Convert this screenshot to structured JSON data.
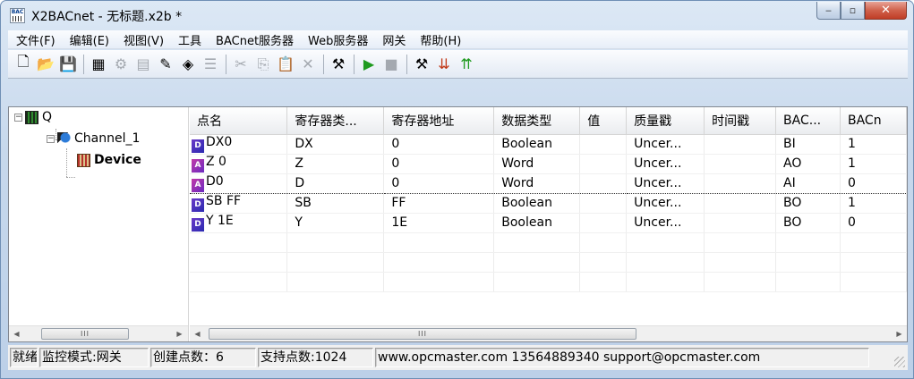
{
  "window": {
    "title": "X2BACnet - 无标题.x2b *",
    "app_icon_text": "BAC",
    "controls": {
      "minimize": "‒",
      "maximize": "▫",
      "close": "✕"
    }
  },
  "menu": [
    "文件(F)",
    "编辑(E)",
    "视图(V)",
    "工具",
    "BACnet服务器",
    "Web服务器",
    "网关",
    "帮助(H)"
  ],
  "toolbar": {
    "buttons": [
      {
        "icon": "new-file-icon",
        "glyph": "🗋",
        "enabled": true
      },
      {
        "icon": "open-folder-icon",
        "glyph": "📂",
        "enabled": true
      },
      {
        "icon": "save-icon",
        "glyph": "💾",
        "enabled": true
      },
      {
        "sep": true
      },
      {
        "icon": "add-channel-icon",
        "glyph": "▦",
        "enabled": true
      },
      {
        "icon": "add-device-icon",
        "glyph": "⚙",
        "enabled": false
      },
      {
        "icon": "add-tag-icon",
        "glyph": "▤",
        "enabled": false
      },
      {
        "icon": "new-tag-icon",
        "glyph": "✎",
        "enabled": true
      },
      {
        "icon": "tag-import-icon",
        "glyph": "◈",
        "enabled": true
      },
      {
        "icon": "properties-icon",
        "glyph": "☰",
        "enabled": false
      },
      {
        "sep": true
      },
      {
        "icon": "cut-icon",
        "glyph": "✂",
        "enabled": false
      },
      {
        "icon": "copy-icon",
        "glyph": "⎘",
        "enabled": false
      },
      {
        "icon": "paste-icon",
        "glyph": "📋",
        "enabled": false
      },
      {
        "icon": "delete-icon",
        "glyph": "✕",
        "enabled": false
      },
      {
        "sep": true
      },
      {
        "icon": "quick-client-icon",
        "glyph": "⚒",
        "enabled": true
      },
      {
        "sep": true
      },
      {
        "icon": "run-icon",
        "glyph": "▶",
        "enabled": true,
        "color": "#1f9a1f"
      },
      {
        "icon": "stop-icon",
        "glyph": "■",
        "enabled": false
      },
      {
        "sep": true
      },
      {
        "icon": "tools-icon",
        "glyph": "⚒",
        "enabled": true
      },
      {
        "icon": "load-icon",
        "glyph": "⇊",
        "enabled": true,
        "color": "#c23a1a"
      },
      {
        "icon": "upload-icon",
        "glyph": "⇈",
        "enabled": true,
        "color": "#1f9a1f"
      }
    ]
  },
  "tree": {
    "root": {
      "expander": "−",
      "label": "Q"
    },
    "channel": {
      "expander": "−",
      "label": "Channel_1"
    },
    "device": {
      "label": "Device"
    }
  },
  "grid": {
    "columns": [
      "点名",
      "寄存器类...",
      "寄存器地址",
      "数据类型",
      "值",
      "质量戳",
      "时间戳",
      "BAC...",
      "BACn"
    ],
    "rows": [
      {
        "tag": "D",
        "name": "DX0",
        "reg_type": "DX",
        "reg_addr": "0",
        "data_type": "Boolean",
        "value": "",
        "quality": "Uncer...",
        "timestamp": "",
        "bac_type": "BI",
        "bac_num": "1"
      },
      {
        "tag": "A",
        "name": "Z 0",
        "reg_type": "Z",
        "reg_addr": "0",
        "data_type": "Word",
        "value": "",
        "quality": "Uncer...",
        "timestamp": "",
        "bac_type": "AO",
        "bac_num": "1"
      },
      {
        "tag": "A",
        "name": "D0",
        "reg_type": "D",
        "reg_addr": "0",
        "data_type": "Word",
        "value": "",
        "quality": "Uncer...",
        "timestamp": "",
        "bac_type": "AI",
        "bac_num": "0"
      },
      {
        "tag": "D",
        "name": "SB FF",
        "reg_type": "SB",
        "reg_addr": "FF",
        "data_type": "Boolean",
        "value": "",
        "quality": "Uncer...",
        "timestamp": "",
        "bac_type": "BO",
        "bac_num": "1"
      },
      {
        "tag": "D",
        "name": "Y 1E",
        "reg_type": "Y",
        "reg_addr": "1E",
        "data_type": "Boolean",
        "value": "",
        "quality": "Uncer...",
        "timestamp": "",
        "bac_type": "BO",
        "bac_num": "0"
      }
    ]
  },
  "status": {
    "ready": "就绪",
    "mode": "监控模式:网关",
    "points_created": "创建点数：6",
    "points_supported": "支持点数:1024",
    "contact": "www.opcmaster.com 13564889340 support@opcmaster.com"
  },
  "scroll": {
    "thumb_grip": "III",
    "left": "◀",
    "right": "▶"
  }
}
